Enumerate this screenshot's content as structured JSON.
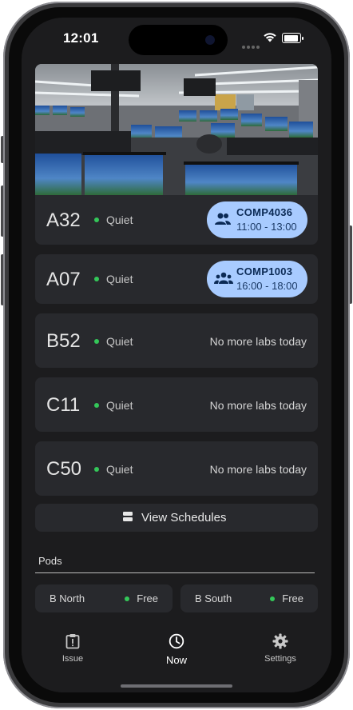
{
  "status_bar": {
    "time": "12:01"
  },
  "banner": {
    "image": "computer-lab-photo"
  },
  "labs": [
    {
      "room": "A32",
      "noise": "Quiet",
      "booking": {
        "code": "COMP4036",
        "time": "11:00 - 13:00",
        "icon": "group-icon"
      }
    },
    {
      "room": "A07",
      "noise": "Quiet",
      "booking": {
        "code": "COMP1003",
        "time": "16:00 - 18:00",
        "icon": "groups-icon"
      }
    },
    {
      "room": "B52",
      "noise": "Quiet",
      "status": "No more labs today"
    },
    {
      "room": "C11",
      "noise": "Quiet",
      "status": "No more labs today"
    },
    {
      "room": "C50",
      "noise": "Quiet",
      "status": "No more labs today"
    }
  ],
  "view_schedules": {
    "label": "View Schedules",
    "icon": "schedule-list-icon"
  },
  "pods": {
    "title": "Pods",
    "items": [
      {
        "name": "B North",
        "status": "Free"
      },
      {
        "name": "B South",
        "status": "Free"
      }
    ]
  },
  "tabs": [
    {
      "label": "Issue",
      "icon": "issue-icon"
    },
    {
      "label": "Now",
      "icon": "clock-icon",
      "active": true
    },
    {
      "label": "Settings",
      "icon": "gear-icon"
    }
  ],
  "colors": {
    "accent": "#a8cbff",
    "available": "#34c759",
    "card": "#28292d",
    "background": "#1c1c1e"
  }
}
